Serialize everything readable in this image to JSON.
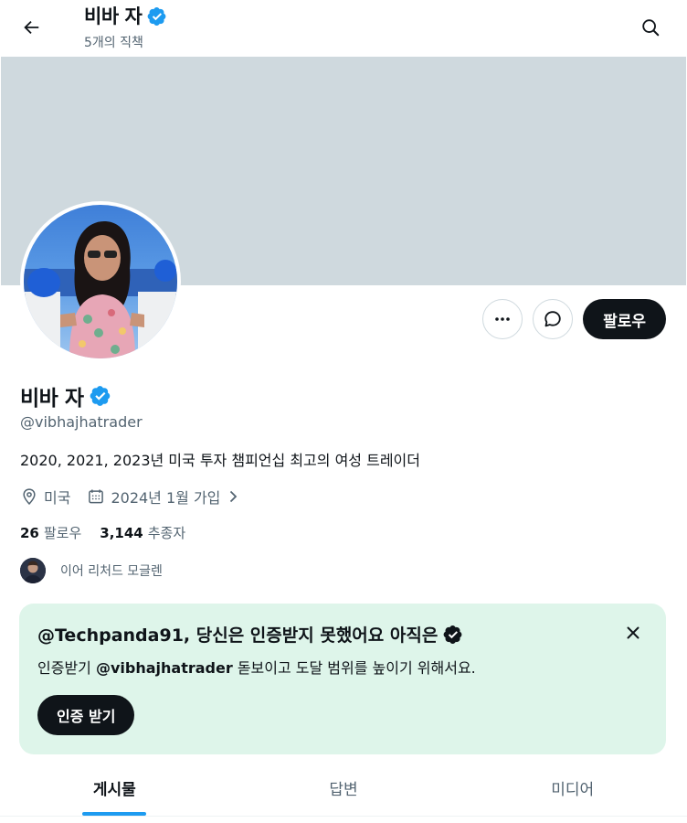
{
  "header": {
    "title": "비바 자",
    "subtitle": "5개의 직책"
  },
  "profile": {
    "name": "비바 자",
    "handle": "@vibhajhatrader",
    "bio": "2020, 2021, 2023년 미국 투자 챔피언십 최고의 여성 트레이더",
    "location": "미국",
    "joined": "2024년 1월 가입",
    "following_count": "26",
    "following_label": "팔로우",
    "followers_count": "3,144",
    "followers_label": "추종자",
    "followed_by": "이어 리처드 모글렌"
  },
  "actions": {
    "follow_label": "팔로우"
  },
  "promo": {
    "title": "@Techpanda91, 당신은 인증받지 못했어요 아직은",
    "body_prefix": "인증받기 ",
    "body_handle": "@vibhajhatrader",
    "body_suffix": " 돋보이고 도달 범위를 높이기 위해서요.",
    "button_label": "인증 받기"
  },
  "tabs": [
    {
      "label": "게시물",
      "active": true
    },
    {
      "label": "답변",
      "active": false
    },
    {
      "label": "미디어",
      "active": false
    }
  ],
  "colors": {
    "verified": "#1d9bf0",
    "banner": "#cfd9de",
    "promo_bg": "#def5ea",
    "accent": "#1d9bf0"
  }
}
